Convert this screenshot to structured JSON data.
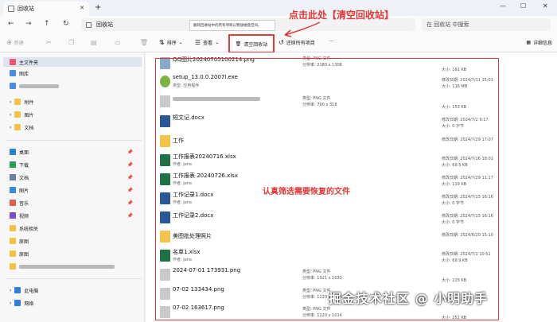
{
  "window": {
    "tab_title": "回收站",
    "new_tab": "+",
    "min": "—",
    "max": "☐",
    "close": "✕"
  },
  "addressbar": {
    "path": "回收站",
    "search_placeholder": "在 回收站 中搜索"
  },
  "toolbar": {
    "new_label": "新建",
    "sort_label": "排序",
    "view_label": "查看",
    "empty_label": "清空回收站",
    "restore_all_label": "还原所有项目",
    "more_label": "···",
    "details_label": "详细信息",
    "tooltip": "删除回收站中的所有项目以释放磁盘空间。"
  },
  "annotations": {
    "empty_hint": "点击此处【清空回收站】",
    "filter_hint": "认真筛选需要恢复的文件",
    "watermark": "掘金技术社区 @ 小明助手"
  },
  "sidebar": {
    "home": "主文件夹",
    "gallery": "图库",
    "folders": [
      "附件",
      "图片",
      "文档"
    ],
    "quick": [
      "桌面",
      "下载",
      "文档",
      "图片",
      "音乐",
      "视频",
      "系统相关",
      "原图",
      "原图"
    ],
    "this_pc": "此电脑",
    "network": "网络"
  },
  "files": [
    {
      "name": "QQ图片20240705100214.png",
      "sub": "",
      "c2a": "类型: PNG 文件",
      "c2b": "分辨率: 2180 x 1308",
      "c3a": "",
      "c3b": "大小: 161 KB",
      "icon": "image"
    },
    {
      "name": "setup_13.0.0.2007l.exe",
      "sub": "类型: 应用程序",
      "c2a": "",
      "c2b": "",
      "c3a": "修改日期: 2024/7/11 15:01",
      "c3b": "大小: 116 MB",
      "icon": "exe"
    },
    {
      "name": "",
      "sub": "",
      "c2a": "类型: PNG 文件",
      "c2b": "分辨率: 700 x 318",
      "c3a": "",
      "c3b": "大小: 153 KB",
      "icon": "image"
    },
    {
      "name": "短文记.docx",
      "sub": "",
      "c2a": "",
      "c2b": "",
      "c3a": "修改日期: 2024/7/2 9:17",
      "c3b": "大小: 0 字节",
      "icon": "word"
    },
    {
      "name": "工作",
      "sub": "",
      "c2a": "",
      "c2b": "",
      "c3a": "修改日期: 2024/7/29 17:07",
      "c3b": "",
      "icon": "folder"
    },
    {
      "name": "工作报表20240716.xlsx",
      "sub": "作者: Jane",
      "c2a": "",
      "c2b": "",
      "c3a": "修改日期: 2024/7/16 18:01",
      "c3b": "大小: 69.5 KB",
      "icon": "excel"
    },
    {
      "name": "工作报表 20240726.xlsx",
      "sub": "作者: Jane",
      "c2a": "",
      "c2b": "",
      "c3a": "修改日期: 2024/7/29 11:17",
      "c3b": "大小: 119 KB",
      "icon": "excel"
    },
    {
      "name": "工作记录1.docx",
      "sub": "作者: Jane",
      "c2a": "",
      "c2b": "",
      "c3a": "修改日期: 2024/7/15 16:16",
      "c3b": "大小: 0 字节",
      "icon": "word"
    },
    {
      "name": "工作记录2.docx",
      "sub": "",
      "c2a": "",
      "c2b": "",
      "c3a": "修改日期: 2024/7/15 16:16",
      "c3b": "大小: 0 字节",
      "icon": "word"
    },
    {
      "name": "美图批处理照片",
      "sub": "",
      "c2a": "",
      "c2b": "",
      "c3a": "修改日期: 2024/6/20 15:10",
      "c3b": "",
      "icon": "folder"
    },
    {
      "name": "名单1.xlsx",
      "sub": "作者: Jane",
      "c2a": "",
      "c2b": "",
      "c3a": "修改日期: 2024/7/1 10:51",
      "c3b": "大小: 69.9 KB",
      "icon": "excel"
    },
    {
      "name": "2024-07-01 173931.png",
      "sub": "",
      "c2a": "类型: PNG 文件",
      "c2b": "分辨率: 1921 x 1033",
      "c3a": "",
      "c3b": "大小: 215 KB",
      "icon": "image"
    },
    {
      "name": "07-02 133434.png",
      "sub": "",
      "c2a": "类型: PNG 文件",
      "c2b": "分辨率: 1220 x 1014",
      "c3a": "",
      "c3b": "大小: 231 KB",
      "icon": "image"
    },
    {
      "name": "07-02 163617.png",
      "sub": "",
      "c2a": "类型: PNG 文件",
      "c2b": "分辨率: 1220 x 1014",
      "c3a": "",
      "c3b": "大小: 252 KB",
      "icon": "image"
    }
  ],
  "colors": {
    "accent": "#e03a3a",
    "folder": "#f3c34a",
    "word": "#2b579a",
    "excel": "#1e7145"
  }
}
